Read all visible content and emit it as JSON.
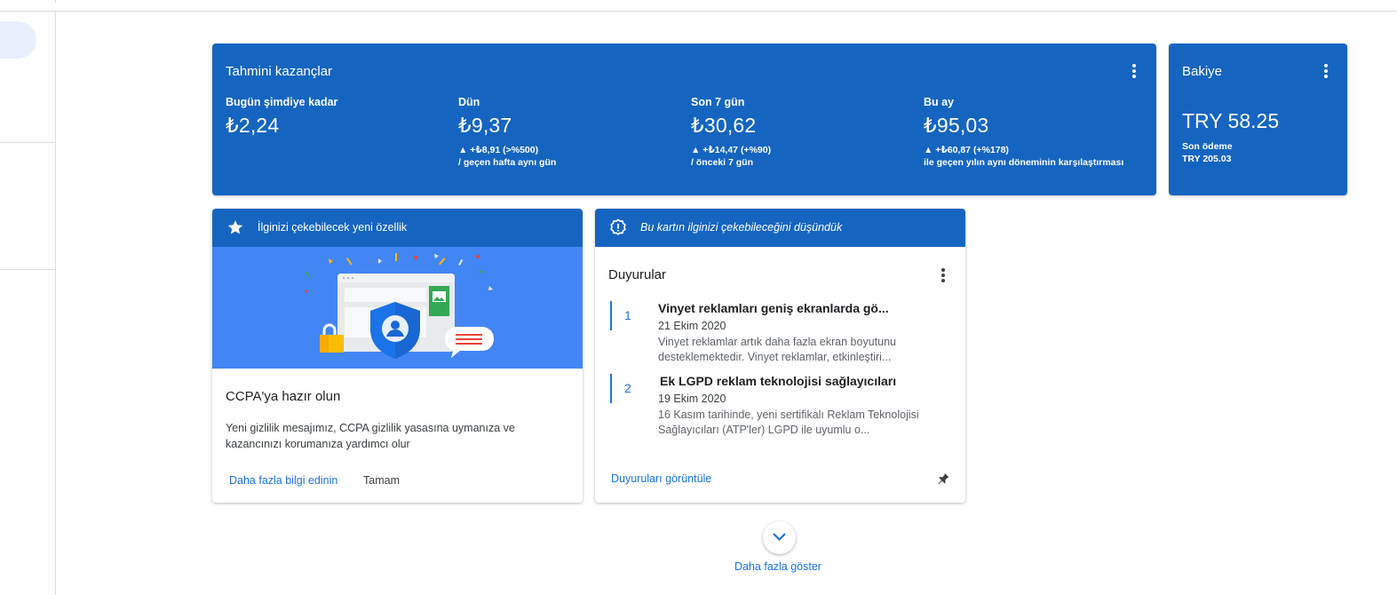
{
  "earnings": {
    "title": "Tahmini kazançlar",
    "metrics": [
      {
        "label": "Bugün şimdiye kadar",
        "value": "₺2,24",
        "delta": "",
        "compare": ""
      },
      {
        "label": "Dün",
        "value": "₺9,37",
        "delta": "▲ +₺8,91 (>%500)",
        "compare": "/ geçen hafta aynı gün"
      },
      {
        "label": "Son 7 gün",
        "value": "₺30,62",
        "delta": "▲ +₺14,47 (+%90)",
        "compare": "/ önceki 7 gün"
      },
      {
        "label": "Bu ay",
        "value": "₺95,03",
        "delta": "▲ +₺60,87 (+%178)",
        "compare": "ile geçen yılın aynı döneminin karşılaştırması"
      }
    ]
  },
  "balance": {
    "title": "Bakiye",
    "value": "TRY 58.25",
    "last_payment_label": "Son ödeme",
    "last_payment_value": "TRY 205.03"
  },
  "feature_card": {
    "header": "İlginizi çekebilecek yeni özellik",
    "title": "CCPA'ya hazır olun",
    "description": "Yeni gizlilik mesajımız, CCPA gizlilik yasasına uymanıza ve kazancınızı korumanıza yardımcı olur",
    "learn_more": "Daha fazla bilgi edinin",
    "ok": "Tamam"
  },
  "announcements_card": {
    "header": "Bu kartın ilginizi çekebileceğini düşündük",
    "title": "Duyurular",
    "items": [
      {
        "num": "1",
        "title": "Vinyet reklamları geniş ekranlarda gö...",
        "date": "21 Ekim 2020",
        "text": "Vinyet reklamlar artık daha fazla ekran boyutunu desteklemektedir. Vinyet reklamlar, etkinleştiri..."
      },
      {
        "num": "2",
        "title": "Ek LGPD reklam teknolojisi sağlayıcıları",
        "date": "19 Ekim 2020",
        "text": "16 Kasım tarihinde, yeni sertifikalı Reklam Teknolojisi Sağlayıcıları (ATP'ler) LGPD ile uyumlu o..."
      }
    ],
    "view_link": "Duyuruları görüntüle"
  },
  "show_more": "Daha fazla göster",
  "colors": {
    "card_blue": "#1565c0",
    "illustration_blue": "#4285f4",
    "link_blue": "#1a73e8"
  }
}
